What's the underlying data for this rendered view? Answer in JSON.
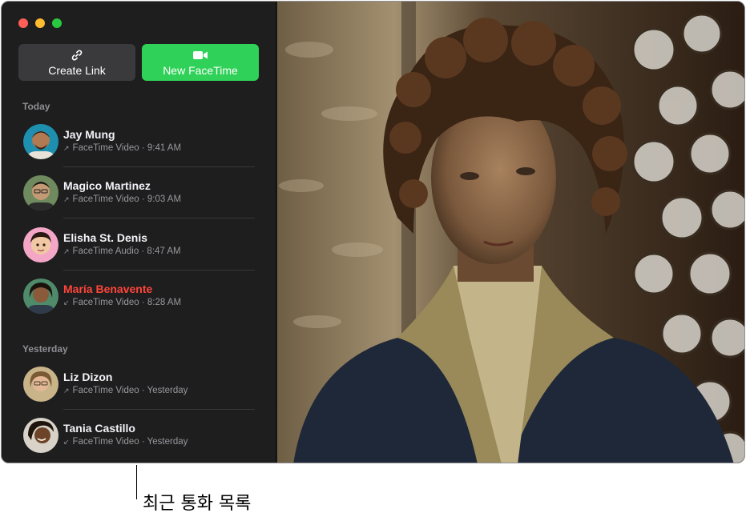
{
  "sidebar": {
    "buttons": {
      "create_link": {
        "label": "Create Link",
        "icon": "link-icon"
      },
      "new_facetime": {
        "label": "New FaceTime",
        "icon": "video-camera-icon",
        "color": "#30d158"
      }
    },
    "sections": [
      {
        "label": "Today",
        "calls": [
          {
            "name": "Jay Mung",
            "detail": "FaceTime Video · 9:41 AM",
            "direction": "outgoing",
            "missed": false,
            "avatar": "avatar-jay-mung"
          },
          {
            "name": "Magico Martinez",
            "detail": "FaceTime Video · 9:03 AM",
            "direction": "outgoing",
            "missed": false,
            "avatar": "avatar-magico-martinez"
          },
          {
            "name": "Elisha St. Denis",
            "detail": "FaceTime Audio · 8:47 AM",
            "direction": "outgoing",
            "missed": false,
            "avatar": "avatar-elisha-st-denis"
          },
          {
            "name": "María Benavente",
            "detail": "FaceTime Video · 8:28 AM",
            "direction": "incoming",
            "missed": true,
            "avatar": "avatar-maria-benavente"
          }
        ]
      },
      {
        "label": "Yesterday",
        "calls": [
          {
            "name": "Liz Dizon",
            "detail": "FaceTime Video · Yesterday",
            "direction": "outgoing",
            "missed": false,
            "avatar": "avatar-liz-dizon"
          },
          {
            "name": "Tania Castillo",
            "detail": "FaceTime Video · Yesterday",
            "direction": "incoming",
            "missed": false,
            "avatar": "avatar-tania-castillo"
          }
        ]
      }
    ]
  },
  "colors": {
    "missed": "#ff453a",
    "accent": "#30d158"
  },
  "callout": {
    "label": "최근 통화 목록"
  }
}
